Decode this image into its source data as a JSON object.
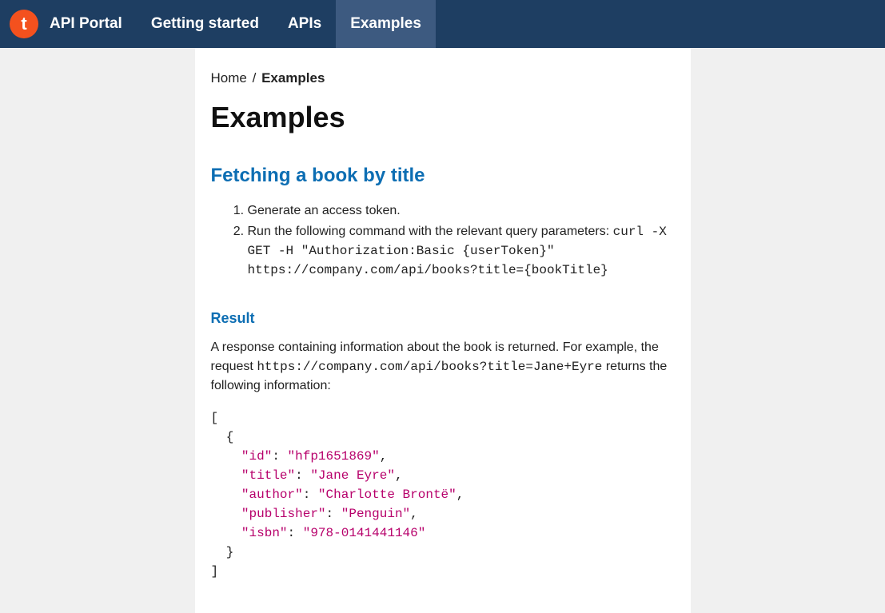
{
  "navbar": {
    "logo_letter": "t",
    "logo_text": "API Portal",
    "items": [
      {
        "label": "Getting started",
        "active": false
      },
      {
        "label": "APIs",
        "active": false
      },
      {
        "label": "Examples",
        "active": true
      }
    ]
  },
  "breadcrumb": {
    "home": "Home",
    "separator": "/",
    "current": "Examples"
  },
  "page_title": "Examples",
  "section": {
    "title": "Fetching a book by title",
    "steps": {
      "step1": "Generate an access token.",
      "step2_prefix": "Run the following command with the relevant query parameters: ",
      "step2_code": "curl -X GET -H \"Authorization:Basic {userToken}\" https://company.com/api/books?title={bookTitle}"
    }
  },
  "result": {
    "heading": "Result",
    "text_prefix": "A response containing information about the book is returned. For example, the request ",
    "text_code": "https://company.com/api/books?title=Jane+Eyre",
    "text_suffix": " returns the following information:",
    "json": {
      "id": "hfp1651869",
      "title": "Jane Eyre",
      "author": "Charlotte Brontë",
      "publisher": "Penguin",
      "isbn": "978-0141441146"
    }
  }
}
